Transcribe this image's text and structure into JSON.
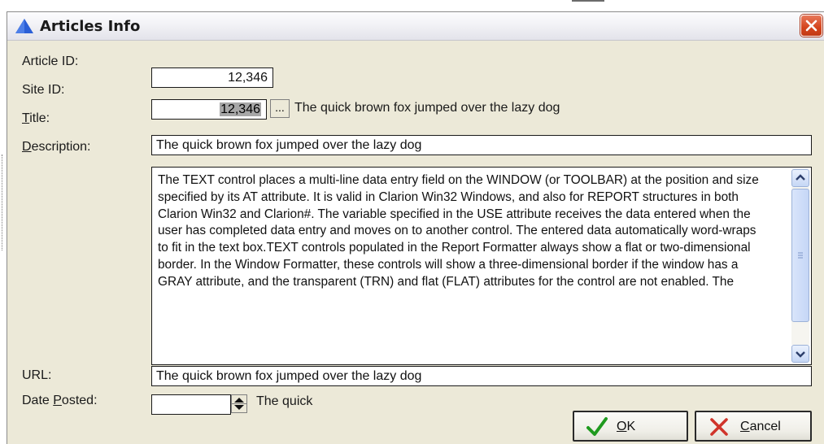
{
  "window": {
    "title": "Articles Info",
    "title_icon": "triangle-icon",
    "close_icon": "close-icon"
  },
  "fields": {
    "article_id": {
      "label": "Article ID:",
      "value": "12,346"
    },
    "site_id": {
      "label": "Site ID:",
      "value": "12,346",
      "lookup_label": "...",
      "description": "The quick brown fox jumped over the lazy dog"
    },
    "title": {
      "label_mnemonic": "T",
      "label_rest": "itle:",
      "value": "The quick brown fox jumped over the lazy dog"
    },
    "description": {
      "label_mnemonic": "D",
      "label_rest": "escription:",
      "value": "The TEXT control places a multi-line data entry field on the WINDOW (or TOOLBAR) at the position and size specified by its AT attribute. It is valid in Clarion Win32 Windows, and also for REPORT structures in both Clarion Win32 and Clarion#. The variable specified in the USE attribute receives the data entered when the user has completed data entry and moves on to another control. The entered data automatically word-wraps to fit in the text box.TEXT controls populated in the Report Formatter always show a flat or two-dimensional border. In the Window Formatter, these controls will show a three-dimensional border if the window has a GRAY attribute, and the transparent (TRN) and flat (FLAT) attributes for the control are not enabled. The"
    },
    "url": {
      "label": "URL:",
      "value": "The quick brown fox jumped over the lazy dog"
    },
    "date_posted": {
      "label_prefix": "Date ",
      "label_mnemonic": "P",
      "label_rest": "osted:",
      "value": "",
      "hint": "The quick"
    }
  },
  "buttons": {
    "ok": {
      "mnemonic": "O",
      "rest": "K",
      "icon": "checkmark-icon",
      "icon_color": "#1f9a1f"
    },
    "cancel": {
      "mnemonic": "C",
      "rest": "ancel",
      "icon": "x-icon",
      "icon_color": "#d0342a"
    }
  },
  "colors": {
    "dialog_bg": "#ece9d8",
    "close_button": "#d4441c",
    "title_icon": "#2b5fd6",
    "selection": "#a7a7a7"
  }
}
